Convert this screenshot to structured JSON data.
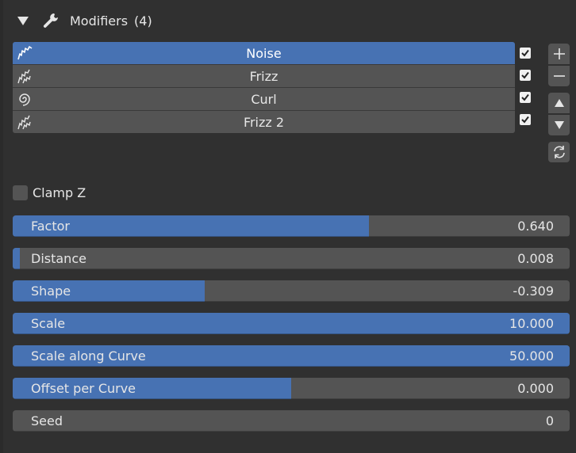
{
  "header": {
    "title": "Modifiers",
    "count": "(4)",
    "expand_icon": "triangle-down-icon",
    "type_icon": "wrench-icon"
  },
  "modifiers": {
    "items": [
      {
        "label": "Noise",
        "icon": "noise-icon",
        "active": true,
        "enabled": true
      },
      {
        "label": "Frizz",
        "icon": "frizz-icon",
        "active": false,
        "enabled": true
      },
      {
        "label": "Curl",
        "icon": "curl-icon",
        "active": false,
        "enabled": true
      },
      {
        "label": "Frizz 2",
        "icon": "frizz-icon",
        "active": false,
        "enabled": true
      }
    ],
    "side_buttons": [
      "plus-icon",
      "minus-icon",
      "move-up-icon",
      "move-down-icon",
      "refresh-icon"
    ]
  },
  "clamp_z": {
    "label": "Clamp Z",
    "checked": false
  },
  "properties": [
    {
      "label": "Factor",
      "value": "0.640",
      "fill_fraction": 0.64
    },
    {
      "label": "Distance",
      "value": "0.008",
      "fill_fraction": 0.008
    },
    {
      "label": "Shape",
      "value": "-0.309",
      "fill_fraction": 0.345
    },
    {
      "label": "Scale",
      "value": "10.000",
      "fill_fraction": 1.0
    },
    {
      "label": "Scale along Curve",
      "value": "50.000",
      "fill_fraction": 1.0
    },
    {
      "label": "Offset per Curve",
      "value": "0.000",
      "fill_fraction": 0.5
    },
    {
      "label": "Seed",
      "value": "0",
      "fill_fraction": 0
    }
  ],
  "colors": {
    "accent": "#4772b3",
    "field": "#545454",
    "panel": "#303030"
  }
}
